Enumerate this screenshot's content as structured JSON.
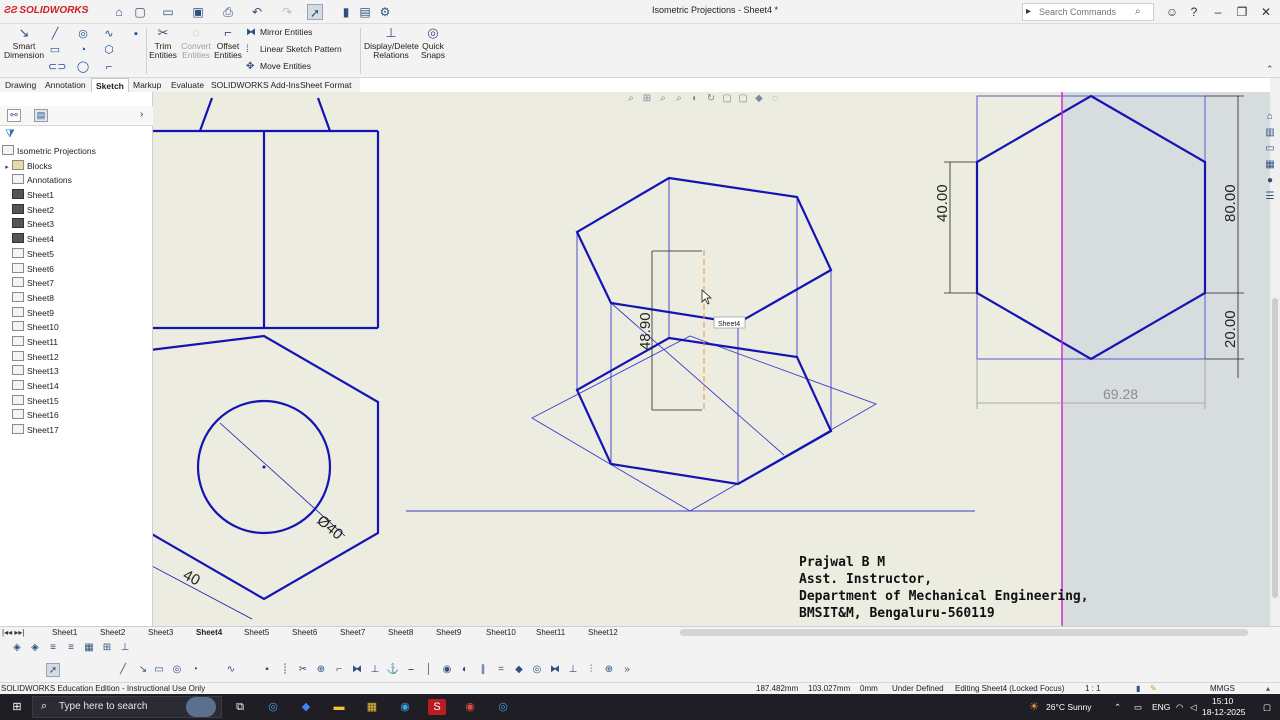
{
  "window": {
    "brand": "SOLIDWORKS",
    "title": "Isometric Projections - Sheet4 *",
    "search_placeholder": "Search Commands"
  },
  "command_manager": {
    "smart_dimension": "Smart Dimension",
    "trim_entities": "Trim Entities",
    "convert_entities": "Convert Entities",
    "offset_entities": "Offset Entities",
    "mirror_entities": "Mirror Entities",
    "linear_sketch_pattern": "Linear Sketch Pattern",
    "move_entities": "Move Entities",
    "display_delete_relations": "Display/Delete Relations",
    "quick_snaps": "Quick Snaps"
  },
  "tabs": [
    "Drawing",
    "Annotation",
    "Sketch",
    "Markup",
    "Evaluate",
    "SOLIDWORKS Add-Ins",
    "Sheet Format"
  ],
  "active_tab": "Sketch",
  "feature_tree": {
    "root": "Isometric Projections",
    "items": [
      "Blocks",
      "Annotations",
      "Sheet1",
      "Sheet2",
      "Sheet3",
      "Sheet4",
      "Sheet5",
      "Sheet6",
      "Sheet7",
      "Sheet8",
      "Sheet9",
      "Sheet10",
      "Sheet11",
      "Sheet12",
      "Sheet13",
      "Sheet14",
      "Sheet15",
      "Sheet16",
      "Sheet17"
    ]
  },
  "drawing": {
    "dim_height": "48.90",
    "dim_40": "40.00",
    "dim_80": "80.00",
    "dim_20": "20.00",
    "dim_width": "69.28",
    "dim_diameter": "Ø40",
    "dim_side": "40",
    "tooltip": "Sheet4",
    "author_line1": "Prajwal B M",
    "author_line2": "Asst. Instructor,",
    "author_line3": "Department of Mechanical Engineering,",
    "author_line4": "BMSIT&M, Bengaluru-560119"
  },
  "sheet_tabs": [
    "Sheet1",
    "Sheet2",
    "Sheet3",
    "Sheet4",
    "Sheet5",
    "Sheet6",
    "Sheet7",
    "Sheet8",
    "Sheet9",
    "Sheet10",
    "Sheet11",
    "Sheet12"
  ],
  "active_sheet": "Sheet4",
  "status": {
    "edition": "SOLIDWORKS Education Edition - Instructional Use Only",
    "x": "187.482mm",
    "y": "103.027mm",
    "z": "0mm",
    "definition": "Under Defined",
    "editing": "Editing Sheet4 (Locked Focus)",
    "scale": "1 : 1",
    "units": "MMGS"
  },
  "taskbar": {
    "search_placeholder": "Type here to search",
    "weather": "26°C  Sunny",
    "lang": "ENG",
    "time": "15:10",
    "date": "18-12-2025"
  },
  "colors": {
    "sketch_blue": "#1414b4",
    "construction_blue": "#3a3ad0",
    "selection_magenta": "#d42ad4",
    "orange_center": "#e8943a",
    "canvas_bg": "#ecece0"
  }
}
